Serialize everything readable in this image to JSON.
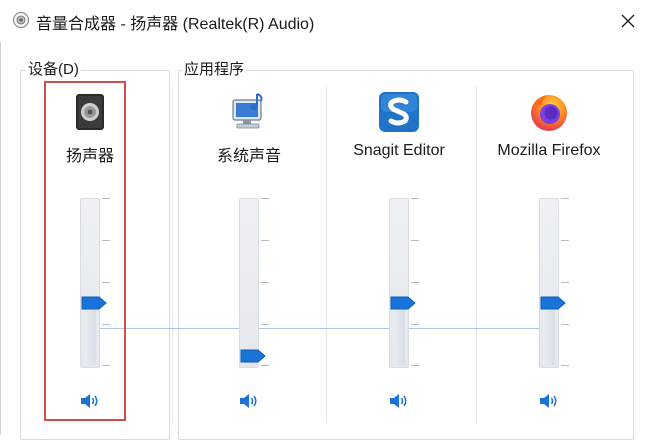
{
  "window": {
    "title": "音量合成器 - 扬声器 (Realtek(R) Audio)",
    "close_icon": "close-icon"
  },
  "groups": {
    "device_label": "设备(D)",
    "apps_label": "应用程序"
  },
  "channels": [
    {
      "id": "speaker",
      "label": "扬声器",
      "icon": "speaker-device-icon",
      "level": 0.36
    },
    {
      "id": "system",
      "label": "系统声音",
      "icon": "system-sounds-icon",
      "level": 0.0
    },
    {
      "id": "snagit",
      "label": "Snagit Editor",
      "icon": "snagit-icon",
      "level": 0.36
    },
    {
      "id": "firefox",
      "label": "Mozilla Firefox",
      "icon": "firefox-icon",
      "level": 0.36
    }
  ],
  "colors": {
    "accent": "#1a73d9",
    "highlight": "#d84b4b"
  }
}
